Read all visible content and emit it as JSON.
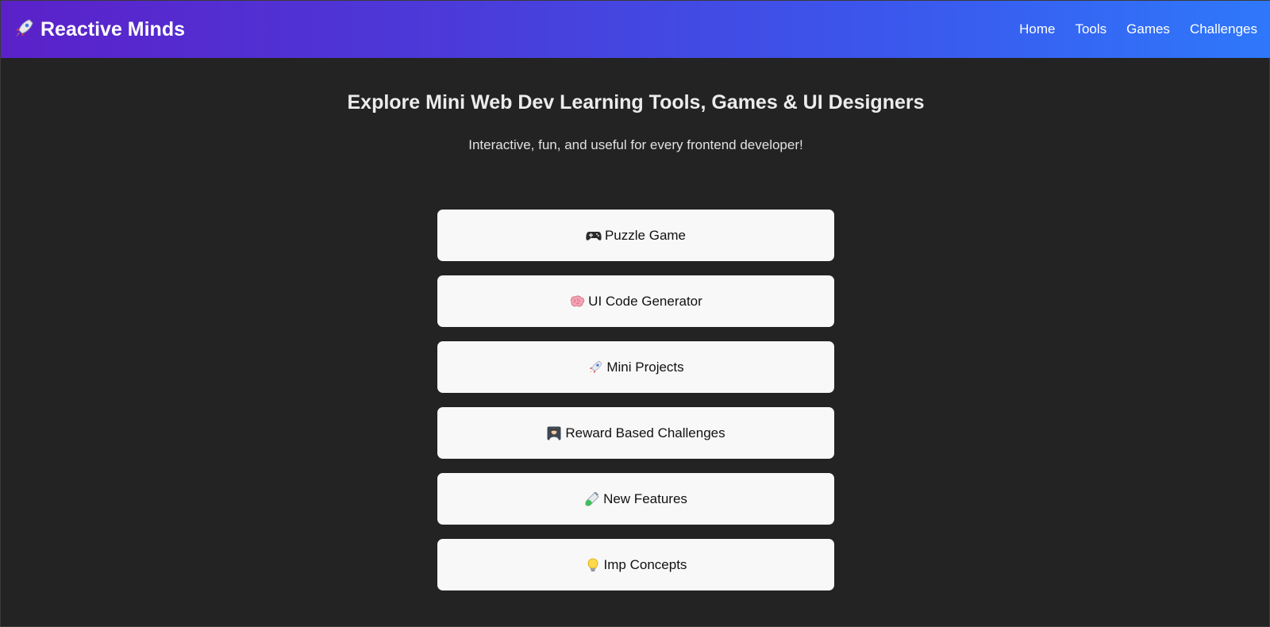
{
  "header": {
    "brand_icon": "rocket-icon",
    "brand": "Reactive Minds",
    "nav": [
      {
        "label": "Home"
      },
      {
        "label": "Tools"
      },
      {
        "label": "Games"
      },
      {
        "label": "Challenges"
      }
    ],
    "gradient_colors": [
      "#5b21c9",
      "#2e78fb"
    ]
  },
  "hero": {
    "title": "Explore Mini Web Dev Learning Tools, Games & UI Designers",
    "subtitle": "Interactive, fun, and useful for every frontend developer!"
  },
  "cards": [
    {
      "icon": "game-controller-icon",
      "label": "Puzzle Game"
    },
    {
      "icon": "brain-icon",
      "label": "UI Code Generator"
    },
    {
      "icon": "rocket-icon",
      "label": "Mini Projects"
    },
    {
      "icon": "teacher-icon",
      "label": "Reward Based Challenges"
    },
    {
      "icon": "test-tube-icon",
      "label": "New Features"
    },
    {
      "icon": "light-bulb-icon",
      "label": "Imp Concepts"
    }
  ],
  "colors": {
    "background": "#232323",
    "card_background": "#f8f8f8",
    "card_text": "#111111"
  }
}
